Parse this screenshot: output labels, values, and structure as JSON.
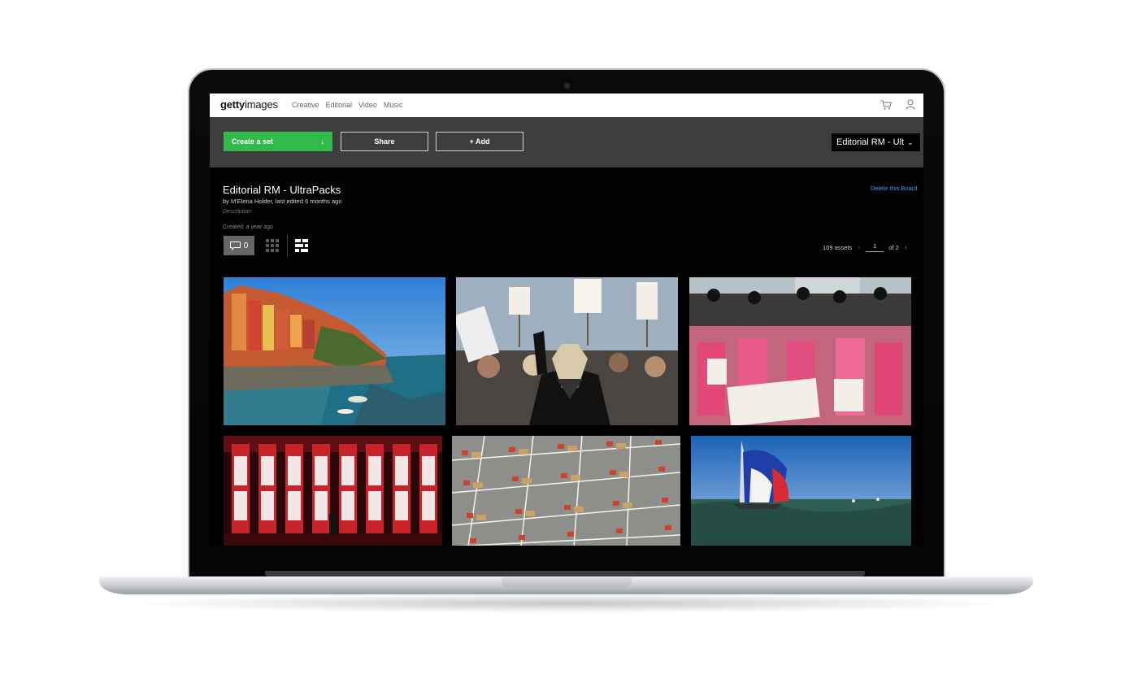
{
  "brand": {
    "logo_bold": "getty",
    "logo_light": "images"
  },
  "nav": {
    "links": [
      "Creative",
      "Editorial",
      "Video",
      "Music"
    ]
  },
  "toolbar": {
    "create_label": "Create a set",
    "share_label": "Share",
    "add_label": "+ Add",
    "board_select_value": "Editorial RM - Ult",
    "create_color": "#31b94a"
  },
  "board": {
    "title": "Editorial RM - UltraPacks",
    "byline": "by M'Elena Holder, last edited 6 months ago",
    "description_placeholder": "Description",
    "created": "Created: a year ago",
    "delete_label": "Delete this Board",
    "comment_count": "0"
  },
  "pagination": {
    "assets": "109 assets",
    "page": "1",
    "of": "of 2"
  },
  "gallery": {
    "items": [
      {
        "subject": "coastal-village"
      },
      {
        "subject": "protest-masks"
      },
      {
        "subject": "pink-protest-police"
      },
      {
        "subject": "truth-justice-building"
      },
      {
        "subject": "exam-desks-aerial"
      },
      {
        "subject": "sailboat-spinnaker"
      }
    ]
  },
  "icons": [
    "cart-icon",
    "user-icon",
    "arrow-down-icon",
    "comment-icon",
    "grid-view-icon",
    "mosaic-view-icon",
    "chevron-left-icon",
    "chevron-right-icon"
  ],
  "colors": {
    "link": "#2ea5ff",
    "toolbar_bg": "#3e3e3e"
  }
}
